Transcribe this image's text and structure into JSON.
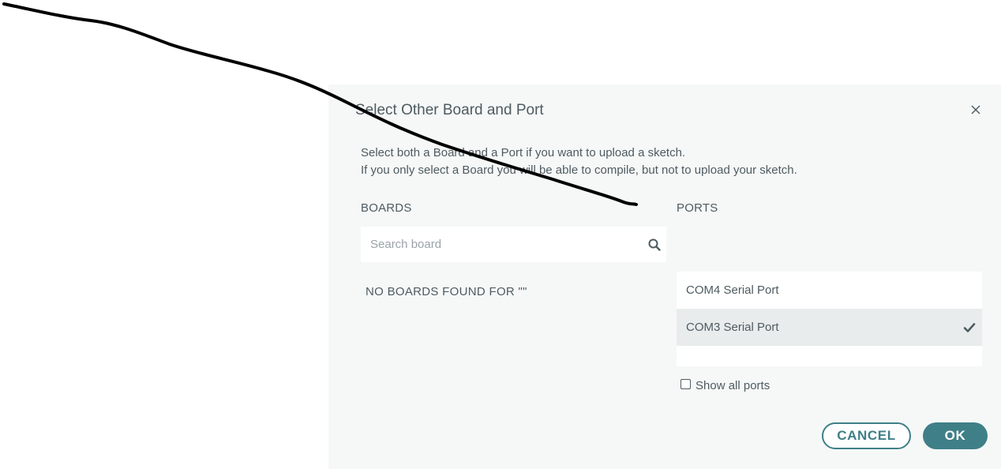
{
  "dialog": {
    "title": "Select Other Board and Port",
    "intro_line1": "Select both a Board and a Port if you want to upload a sketch.",
    "intro_line2": "If you only select a Board you will be able to compile, but not to upload your sketch."
  },
  "boards": {
    "label": "BOARDS",
    "search_placeholder": "Search board",
    "search_value": "",
    "empty_message": "NO BOARDS FOUND FOR \"\""
  },
  "ports": {
    "label": "PORTS",
    "items": [
      {
        "label": "COM4 Serial Port",
        "selected": false
      },
      {
        "label": "COM3 Serial Port",
        "selected": true
      }
    ],
    "show_all_label": "Show all ports",
    "show_all_checked": false
  },
  "actions": {
    "cancel_label": "CANCEL",
    "ok_label": "OK"
  },
  "icons": {
    "close": "close-icon",
    "search": "search-icon",
    "check": "checkmark-icon"
  },
  "colors": {
    "accent": "#3f7f87",
    "dialog_bg": "#f6f8f7",
    "text": "#4e5b61",
    "selected_row": "#e9ecec"
  }
}
